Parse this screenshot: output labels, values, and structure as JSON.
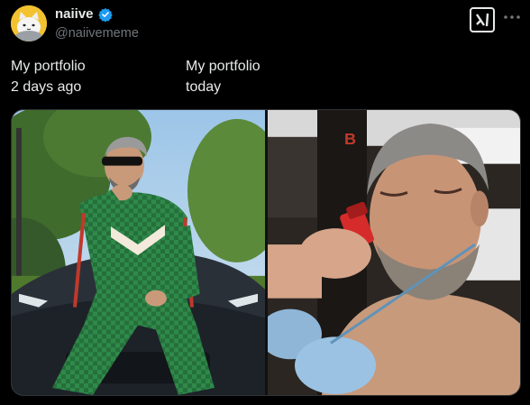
{
  "post": {
    "author": {
      "display_name": "naiive",
      "handle": "@naiivememe",
      "verified": true,
      "avatar_icon": "cat-avatar-icon"
    },
    "actions": {
      "grok_icon": "grok-icon",
      "more_icon": "more-options-icon"
    },
    "caption": {
      "left_line1": "My portfolio",
      "left_line2": "2 days ago",
      "right_line1": "My portfolio",
      "right_line2": "today"
    }
  },
  "colors": {
    "background": "#000000",
    "text_primary": "#e7e9ea",
    "text_secondary": "#71767b",
    "verified_blue": "#1d9bf0",
    "avatar_yellow": "#f2c230"
  }
}
